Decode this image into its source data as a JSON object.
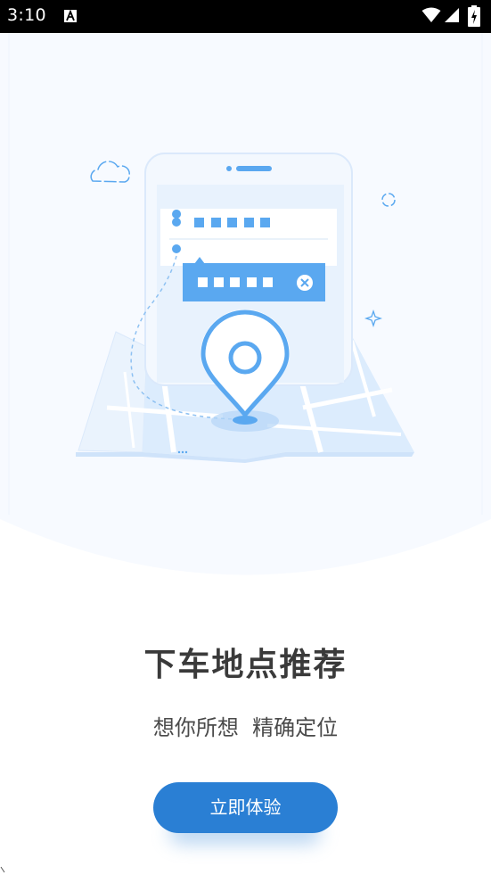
{
  "status_bar": {
    "time": "3:10",
    "icons": [
      "accessibility-icon",
      "wifi-icon",
      "signal-icon",
      "battery-icon"
    ]
  },
  "onboarding": {
    "title": "下车地点推荐",
    "subtitle": "想你所想  精确定位",
    "cta_label": "立即体验"
  },
  "colors": {
    "accent": "#2a7fd4",
    "illustration_blue": "#5aa8f0",
    "hero_background": "#f7faff",
    "title_text": "#3a3a3a"
  }
}
